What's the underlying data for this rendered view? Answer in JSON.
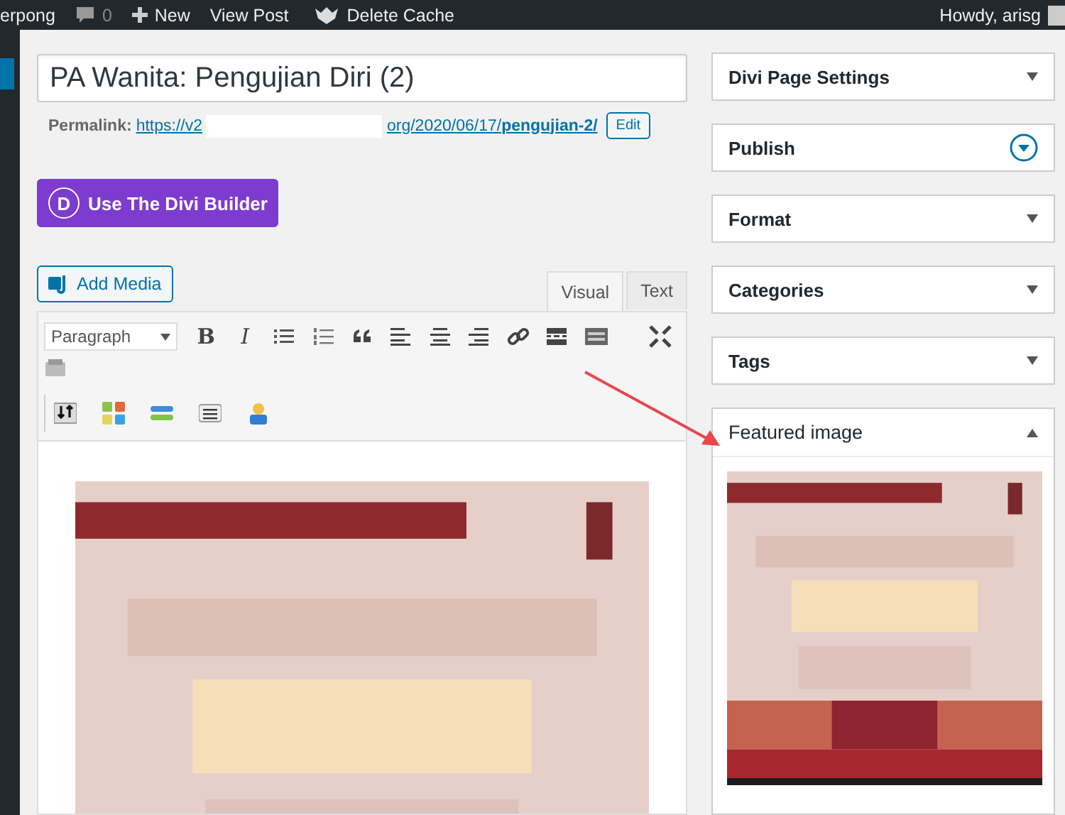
{
  "admin_bar": {
    "site": "erpong",
    "comments": "0",
    "new": "New",
    "view_post": "View Post",
    "delete_cache": "Delete Cache",
    "greeting": "Howdy, arisg"
  },
  "editor": {
    "title": "PA Wanita: Pengujian Diri (2)",
    "permalink_label": "Permalink:",
    "permalink_start": "https://v2",
    "permalink_end": "org/2020/06/17/**pengujian-2/**",
    "edit": "Edit",
    "divi_letter": "D",
    "divi_button": "Use The Divi Builder",
    "add_media": "Add Media",
    "tabs": [
      {
        "label": "Visual",
        "selected": true
      },
      {
        "label": "Text",
        "selected": false
      }
    ],
    "format_select": "Paragraph",
    "bold": "B",
    "italic": "I"
  },
  "sidebar": {
    "panels": [
      {
        "title": "Divi Page Settings",
        "kind": "collapsed"
      },
      {
        "title": "Publish",
        "kind": "circle"
      },
      {
        "title": "Format",
        "kind": "collapsed"
      },
      {
        "title": "Categories",
        "kind": "collapsed"
      },
      {
        "title": "Tags",
        "kind": "collapsed"
      },
      {
        "title": "Featured image",
        "kind": "expanded"
      }
    ]
  }
}
